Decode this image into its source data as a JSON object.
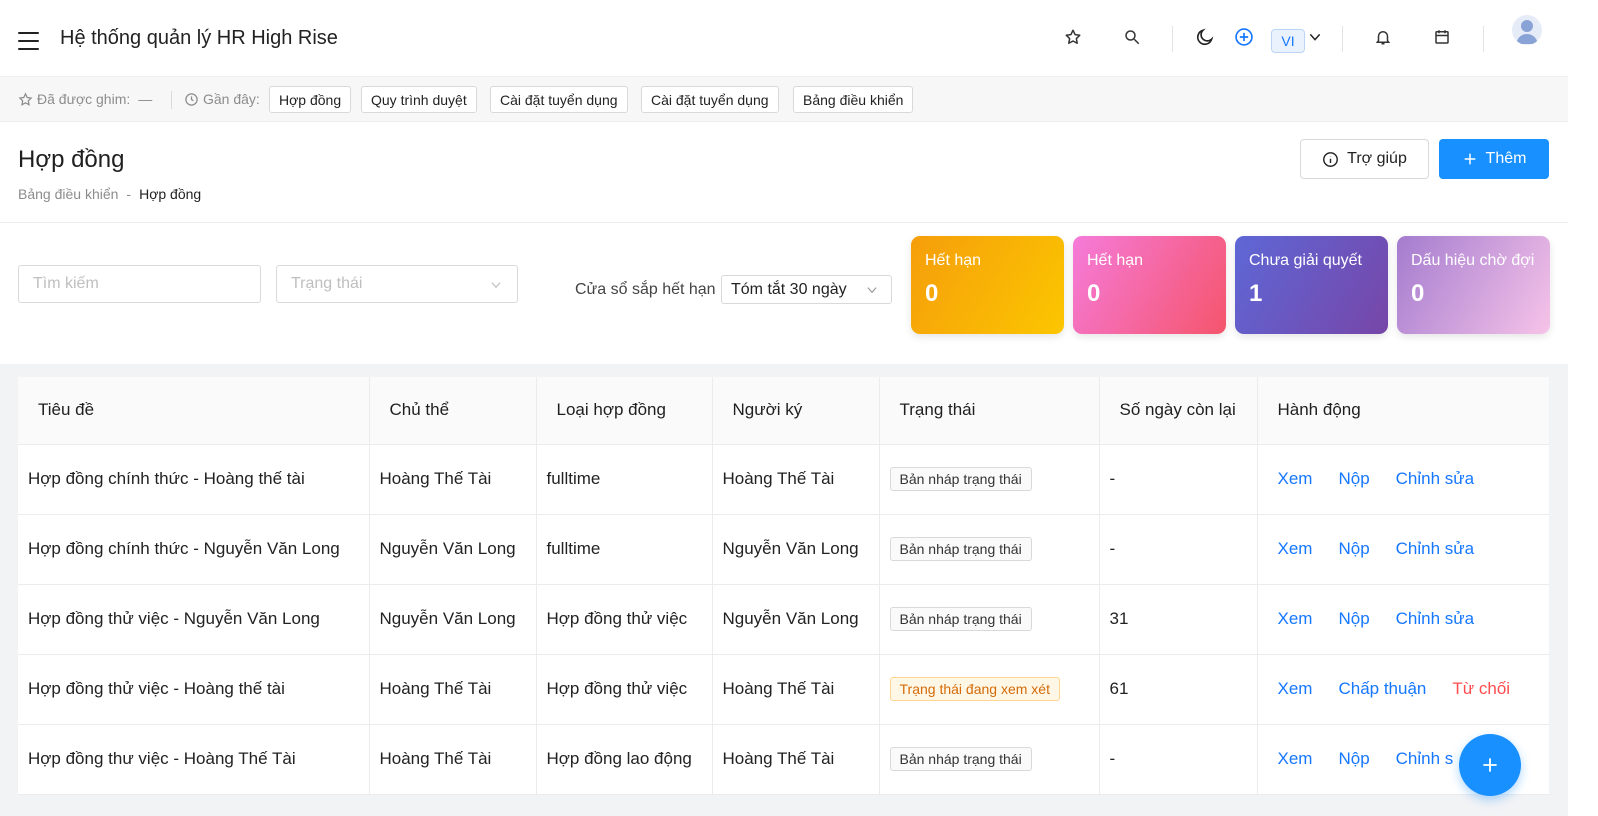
{
  "header": {
    "app_title": "Hệ thống quản lý HR High Rise",
    "language": "VI"
  },
  "pinbar": {
    "pinned_label": "Đã được ghim:",
    "pinned_value": "—",
    "recent_label": "Gần đây:",
    "recent_items": [
      "Hợp đồng",
      "Quy trình duyệt",
      "Cài đặt tuyển dụng",
      "Cài đặt tuyển dụng",
      "Bảng điều khiển"
    ]
  },
  "page": {
    "title": "Hợp đồng",
    "breadcrumb_parent": "Bảng điều khiển",
    "breadcrumb_sep": "-",
    "breadcrumb_current": "Hợp đồng",
    "help_label": "Trợ giúp",
    "add_label": "Thêm"
  },
  "filters": {
    "search_placeholder": "Tìm kiếm",
    "status_placeholder": "Trạng thái",
    "window_label": "Cửa sổ sắp hết hạn",
    "window_value": "Tóm tắt 30 ngày"
  },
  "cards": [
    {
      "label": "Hết hạn",
      "value": "0"
    },
    {
      "label": "Hết hạn",
      "value": "0"
    },
    {
      "label": "Chưa giải quyết",
      "value": "1"
    },
    {
      "label": "Dấu hiệu chờ đợi",
      "value": "0"
    }
  ],
  "table": {
    "headers": [
      "Tiêu đề",
      "Chủ thể",
      "Loại hợp đồng",
      "Người ký",
      "Trạng thái",
      "Số ngày còn lại",
      "Hành động"
    ],
    "rows": [
      {
        "title": "Hợp đồng chính thức - Hoàng thế tài",
        "subject": "Hoàng Thế Tài",
        "type": "fulltime",
        "signer": "Hoàng Thế Tài",
        "status": "Bản nháp trạng thái",
        "days": "-",
        "actions": [
          "Xem",
          "Nộp",
          "Chỉnh sửa"
        ]
      },
      {
        "title": "Hợp đồng chính thức - Nguyễn Văn Long",
        "subject": "Nguyễn Văn Long",
        "type": "fulltime",
        "signer": "Nguyễn Văn Long",
        "status": "Bản nháp trạng thái",
        "days": "-",
        "actions": [
          "Xem",
          "Nộp",
          "Chỉnh sửa"
        ]
      },
      {
        "title": "Hợp đồng thử việc - Nguyễn Văn Long",
        "subject": "Nguyễn Văn Long",
        "type": "Hợp đồng thử việc",
        "signer": "Nguyễn Văn Long",
        "status": "Bản nháp trạng thái",
        "days": "31",
        "actions": [
          "Xem",
          "Nộp",
          "Chỉnh sửa"
        ]
      },
      {
        "title": "Hợp đồng thử việc - Hoàng thế tài",
        "subject": "Hoàng Thế Tài",
        "type": "Hợp đồng thử việc",
        "signer": "Hoàng Thế Tài",
        "status": "Trạng thái đang xem xét",
        "days": "61",
        "actions": [
          "Xem",
          "Chấp thuận",
          "Từ chối"
        ]
      },
      {
        "title": "Hợp đồng thư việc - Hoàng Thế Tài",
        "subject": "Hoàng Thế Tài",
        "type": "Hợp đồng lao động",
        "signer": "Hoàng Thế Tài",
        "status": "Bản nháp trạng thái",
        "days": "-",
        "actions": [
          "Xem",
          "Nộp",
          "Chỉnh s"
        ]
      }
    ]
  },
  "colors": {
    "primary": "#1890ff",
    "danger": "#ff4d4f",
    "review_tag": "#d46b08"
  }
}
